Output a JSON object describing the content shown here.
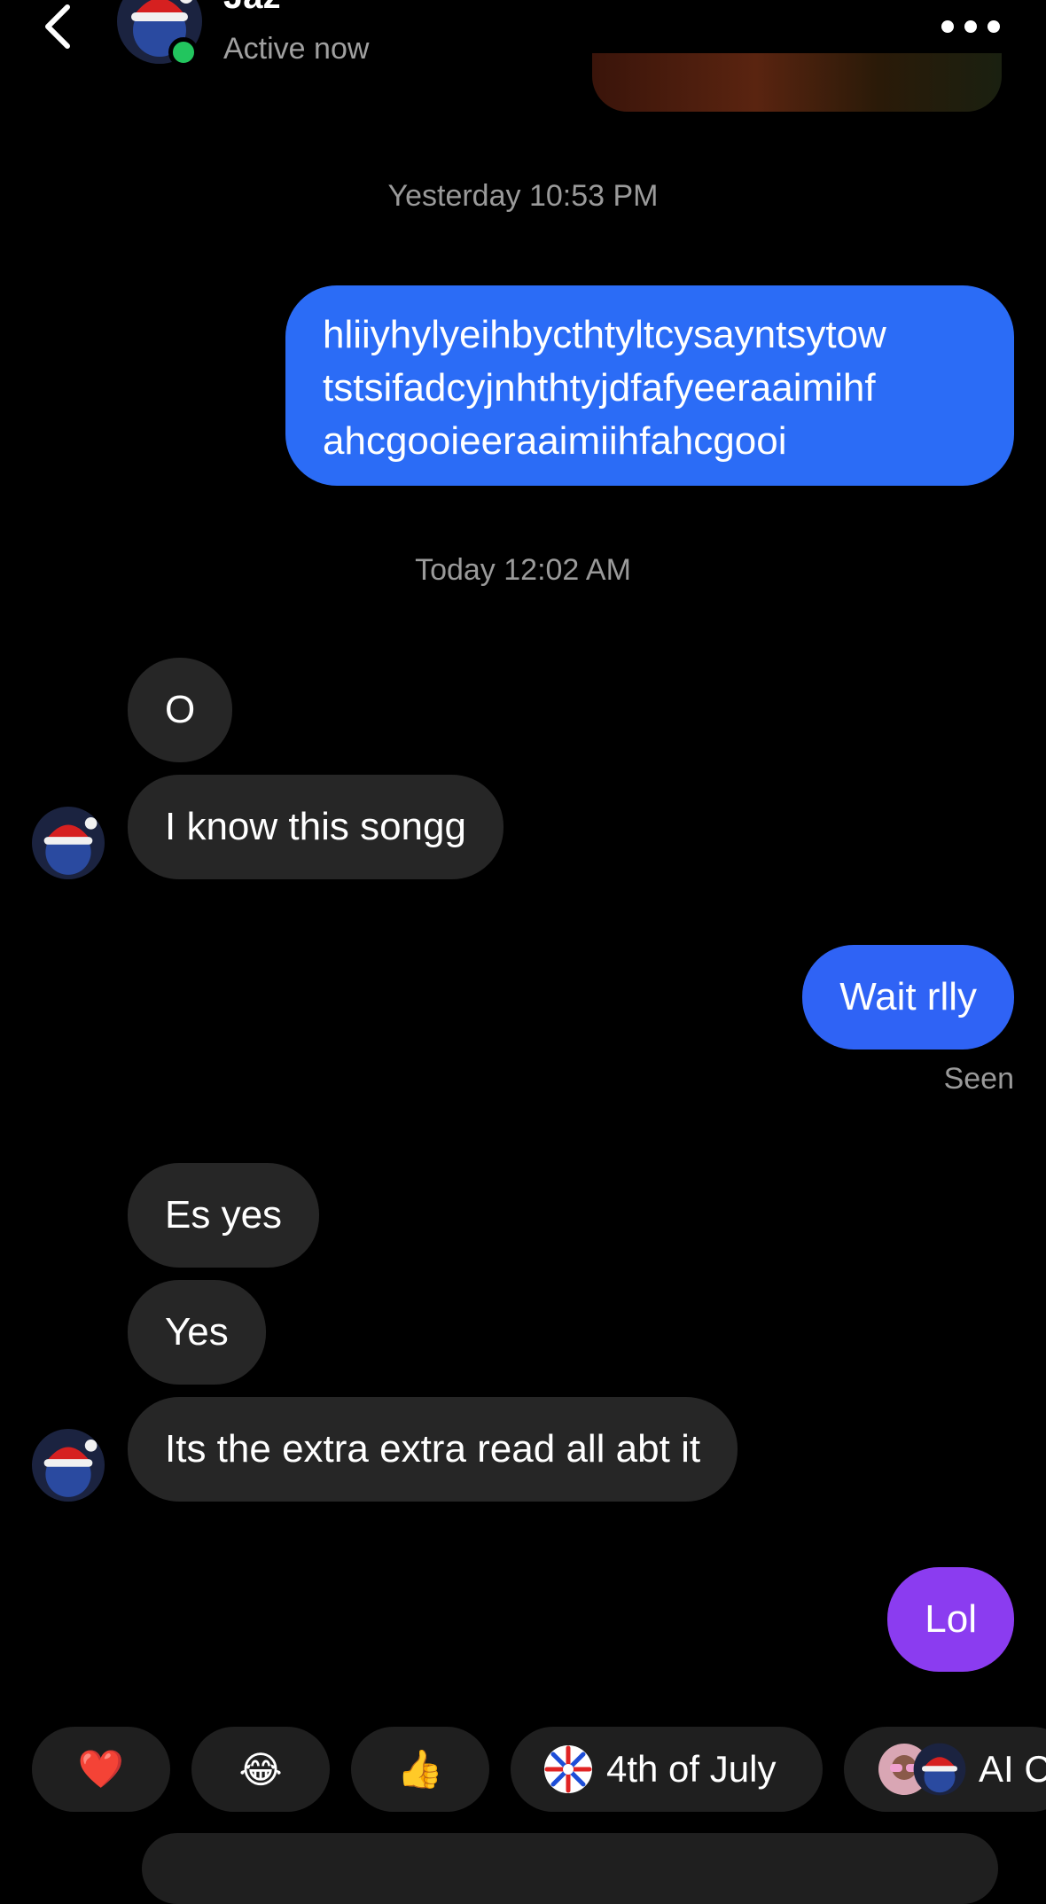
{
  "header": {
    "contact_name": "Jaz",
    "status": "Active now",
    "icons": {
      "back": "chevron-left-icon",
      "more": "more-horizontal-icon"
    }
  },
  "conversation": {
    "ts1": "Yesterday 10:53 PM",
    "msg_out_long": "hliiyhylyeihbycthtyltcysayntsytowtstsifadcyjnhthtyjdfafyeeraaimihfahcgooieeraaimiihfahcgooi",
    "msg_out_long_lines": [
      "hliiyhylyeihbycthtyltcysayntsytow",
      "tstsifadcyjnhthtyjdfafyeeraaimihf",
      "ahcgooieeraaimiihfahcgooi"
    ],
    "ts2": "Today 12:02 AM",
    "msg_in_1": "O",
    "msg_in_2": "I know this songg",
    "msg_out_2": "Wait rlly",
    "seen": "Seen",
    "msg_in_3": "Es yes",
    "msg_in_4": "Yes",
    "msg_in_5": "Its the extra extra read all abt it",
    "msg_out_3": "Lol"
  },
  "quick_replies": {
    "heart": "❤️",
    "laugh": "😂",
    "thumbs": "👍",
    "july_label": "4th of July",
    "ai_label": "AI C"
  },
  "colors": {
    "outgoing_blue": "#2f63f5",
    "outgoing_purple": "#8b3cf0",
    "incoming_gray": "#262626",
    "online_green": "#22c55e"
  }
}
